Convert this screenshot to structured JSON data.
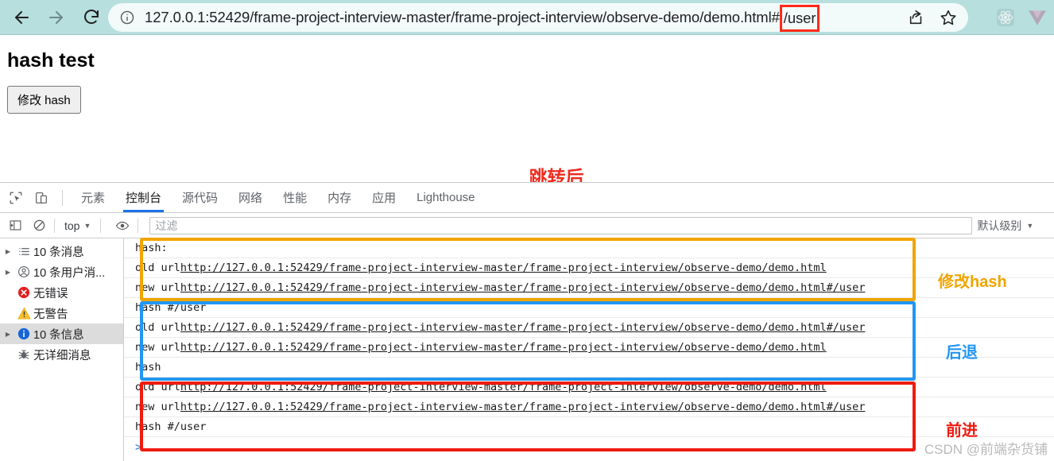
{
  "browser": {
    "back_icon": "arrow-left-icon",
    "forward_icon": "arrow-right-icon",
    "reload_icon": "reload-icon",
    "site_info_icon": "info-circle-icon",
    "url_main": "127.0.0.1:52429/frame-project-interview-master/frame-project-interview/observe-demo/demo.html#",
    "url_highlight": "/user",
    "url_highlight_color": "#ff2a18",
    "share_icon": "share-icon",
    "bookmark_icon": "star-icon",
    "extensions": [
      {
        "name": "react-devtools-icon",
        "glyph": "react"
      },
      {
        "name": "vue-devtools-icon",
        "glyph": "V"
      }
    ],
    "chrome_color": "#b7dfde"
  },
  "page": {
    "title": "hash test",
    "button_label": "修改 hash",
    "jump_note": "跳转后",
    "jump_note_color": "#ef2b1f"
  },
  "devtools": {
    "inspect_icon": "inspect-element-icon",
    "device_icon": "device-toolbar-icon",
    "tabs": [
      {
        "label": "元素",
        "active": false
      },
      {
        "label": "控制台",
        "active": true
      },
      {
        "label": "源代码",
        "active": false
      },
      {
        "label": "网络",
        "active": false
      },
      {
        "label": "性能",
        "active": false
      },
      {
        "label": "内存",
        "active": false
      },
      {
        "label": "应用",
        "active": false
      },
      {
        "label": "Lighthouse",
        "active": false
      }
    ],
    "active_tab_color": "#1a73e8",
    "filterbar": {
      "sidebar_toggle_icon": "show-console-sidebar-icon",
      "clear_icon": "clear-console-icon",
      "context": "top",
      "context_caret": "▼",
      "eye_icon": "live-expression-eye-icon",
      "filter_placeholder": "过滤",
      "levels_label": "默认级别",
      "levels_caret": "▼"
    },
    "sidebar": [
      {
        "arrow": "▶",
        "icon": "message-list-icon",
        "label": "10 条消息",
        "selected": false
      },
      {
        "arrow": "▶",
        "icon": "user-message-icon",
        "label": "10 条用户消...",
        "selected": false
      },
      {
        "arrow": "",
        "icon": "error-icon",
        "label": "无错误",
        "selected": false
      },
      {
        "arrow": "",
        "icon": "warning-icon",
        "label": "无警告",
        "selected": false
      },
      {
        "arrow": "▶",
        "icon": "info-icon",
        "label": "10 条信息",
        "selected": true
      },
      {
        "arrow": "",
        "icon": "verbose-bug-icon",
        "label": "无详细消息",
        "selected": false
      }
    ],
    "log_lines": [
      {
        "prefix": "hash:",
        "link": ""
      },
      {
        "prefix": "old url ",
        "link": "http://127.0.0.1:52429/frame-project-interview-master/frame-project-interview/observe-demo/demo.html"
      },
      {
        "prefix": "new url ",
        "link": "http://127.0.0.1:52429/frame-project-interview-master/frame-project-interview/observe-demo/demo.html#/user"
      },
      {
        "prefix": "hash #/user",
        "link": ""
      },
      {
        "prefix": "old url ",
        "link": "http://127.0.0.1:52429/frame-project-interview-master/frame-project-interview/observe-demo/demo.html#/user"
      },
      {
        "prefix": "new url ",
        "link": "http://127.0.0.1:52429/frame-project-interview-master/frame-project-interview/observe-demo/demo.html"
      },
      {
        "prefix": "hash",
        "link": ""
      },
      {
        "prefix": "old url ",
        "link": "http://127.0.0.1:52429/frame-project-interview-master/frame-project-interview/observe-demo/demo.html"
      },
      {
        "prefix": "new url ",
        "link": "http://127.0.0.1:52429/frame-project-interview-master/frame-project-interview/observe-demo/demo.html#/user"
      },
      {
        "prefix": "hash #/user",
        "link": ""
      }
    ],
    "prompt_symbol": ">"
  },
  "annotations": [
    {
      "label": "修改hash",
      "color": "#f0a500"
    },
    {
      "label": "后退",
      "color": "#2196f3"
    },
    {
      "label": "前进",
      "color": "#ee1b10"
    }
  ],
  "watermark": "CSDN @前端杂货铺"
}
